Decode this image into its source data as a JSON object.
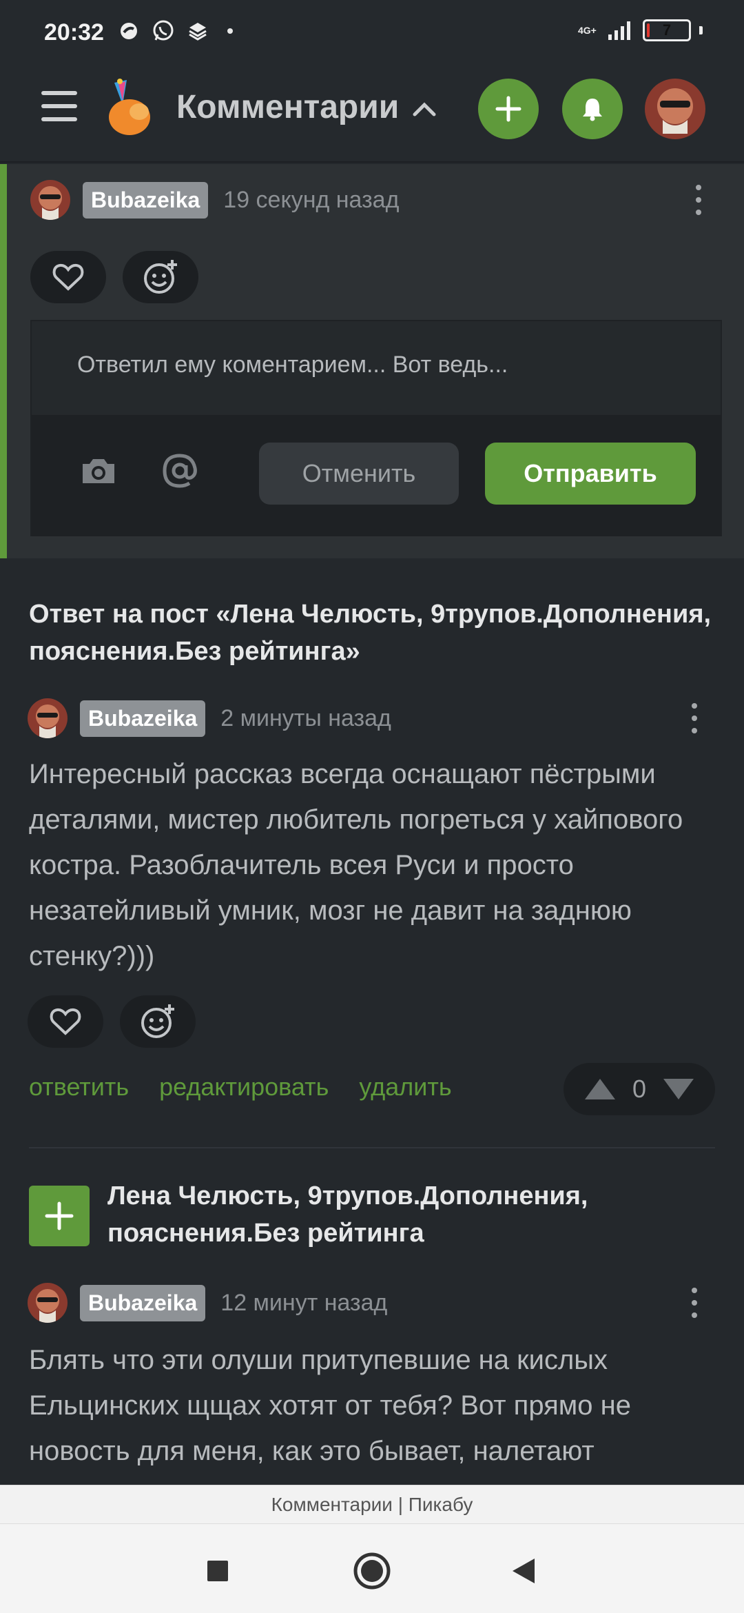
{
  "status": {
    "time": "20:32",
    "network": "4G+",
    "battery": "7",
    "battery_level": 0.07
  },
  "header": {
    "title": "Комментарии",
    "accent": "#5f9a3b"
  },
  "active_comment": {
    "username": "Bubazeika",
    "time": "19 секунд назад",
    "reply_text": "Ответил ему коментарием... Вот ведь...",
    "cancel_label": "Отменить",
    "send_label": "Отправить"
  },
  "comments": [
    {
      "post_title": "Ответ на пост «Лена Челюсть, 9трупов.Дополнения, пояснения.Без рейтинга»",
      "username": "Bubazeika",
      "time": "2 минуты назад",
      "text": "Интересный рассказ всегда оснащают пёстрыми деталями, мистер любитель погреться у хайпового костра. Разоблачитель всея Руси и просто незатейливый умник, мозг не давит на заднюю стенку?)))",
      "actions": {
        "reply": "ответить",
        "edit": "редактировать",
        "delete": "удалить"
      },
      "rating": "0"
    },
    {
      "post_title": "Лена Челюсть, 9трупов.Дополнения, пояснения.Без рейтинга",
      "username": "Bubazeika",
      "time": "12 минут назад",
      "text": "Блять что эти олуши притупевшие на кислых Ельцинских щщах хотят от тебя? Вот прямо не новость для меня, как это бывает, налетают"
    }
  ],
  "footer": {
    "tab_title": "Комментарии | Пикабу"
  }
}
